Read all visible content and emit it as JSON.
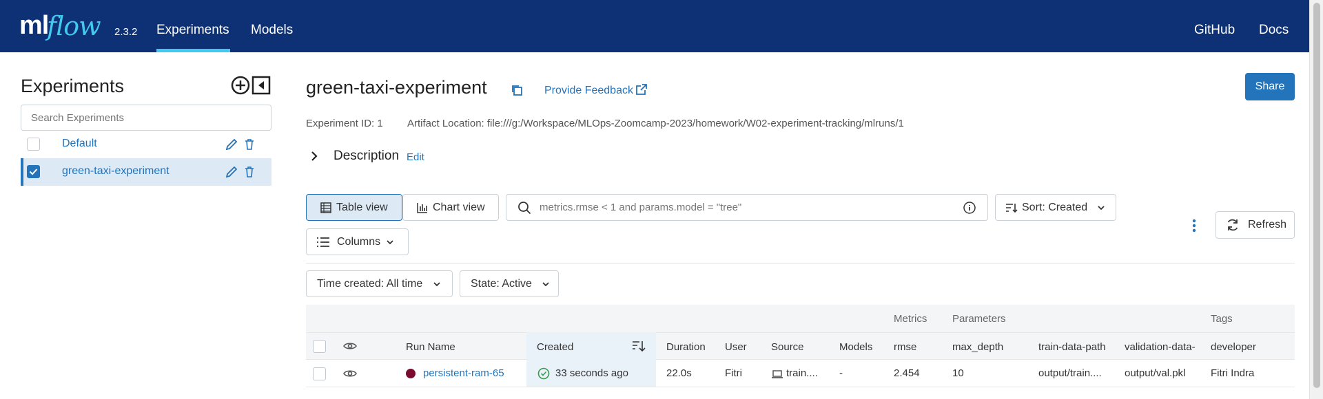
{
  "header": {
    "logo_ml": "ml",
    "logo_flow": "flow",
    "version": "2.3.2",
    "nav": [
      "Experiments",
      "Models"
    ],
    "right_links": [
      "GitHub",
      "Docs"
    ]
  },
  "sidebar": {
    "title": "Experiments",
    "search_placeholder": "Search Experiments",
    "items": [
      {
        "name": "Default",
        "checked": false
      },
      {
        "name": "green-taxi-experiment",
        "checked": true
      }
    ]
  },
  "experiment": {
    "title": "green-taxi-experiment",
    "feedback": "Provide Feedback",
    "share": "Share",
    "id_text": "Experiment ID: 1",
    "artifact_text": "Artifact Location: file:///g:/Workspace/MLOps-Zoomcamp-2023/homework/W02-experiment-tracking/mlruns/1",
    "description": "Description",
    "edit": "Edit"
  },
  "toolbar": {
    "table_view": "Table view",
    "chart_view": "Chart view",
    "search_placeholder": "metrics.rmse < 1 and params.model = \"tree\"",
    "sort": "Sort: Created",
    "columns": "Columns",
    "refresh": "Refresh",
    "time_filter": "Time created: All time",
    "state_filter": "State: Active"
  },
  "table": {
    "groups": {
      "metrics": "Metrics",
      "parameters": "Parameters",
      "tags": "Tags"
    },
    "headers": [
      "Run Name",
      "Created",
      "Duration",
      "User",
      "Source",
      "Models",
      "rmse",
      "max_depth",
      "train-data-path",
      "validation-data-",
      "developer"
    ],
    "rows": [
      {
        "run_name": "persistent-ram-65",
        "run_color": "#7a0b2e",
        "created": "33 seconds ago",
        "duration": "22.0s",
        "user": "Fitri",
        "source": "train....",
        "models": "-",
        "rmse": "2.454",
        "max_depth": "10",
        "train_data_path": "output/train....",
        "validation_data": "output/val.pkl",
        "developer": "Fitri Indra"
      }
    ]
  }
}
